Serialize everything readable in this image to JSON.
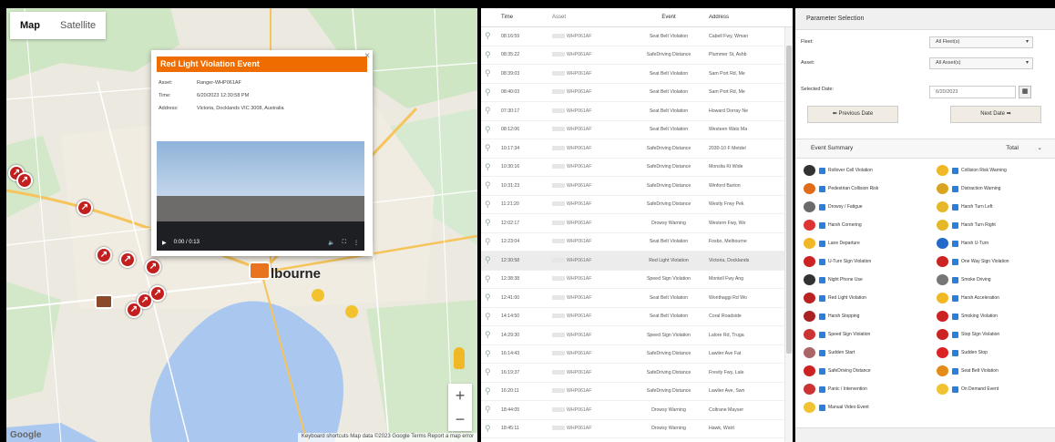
{
  "map": {
    "tabs": [
      "Map",
      "Satellite"
    ],
    "city_label": "lbourne",
    "zoom_in": "+",
    "zoom_out": "−",
    "google": "Google",
    "footer": "Keyboard shortcuts   Map data ©2023 Google   Terms   Report a map error"
  },
  "popup": {
    "title": "Red Light Violation Event",
    "close": "×",
    "rows": [
      {
        "k": "Asset:",
        "v": "Ranger-WHP061AF"
      },
      {
        "k": "Time:",
        "v": "6/20/2023 12:30:58 PM"
      },
      {
        "k": "Address:",
        "v": "Victoria, Docklands VIC 3008, Australia"
      }
    ],
    "video_time": "0:00 / 0:13"
  },
  "table": {
    "headers": [
      "",
      "Time",
      "Asset",
      "Event",
      "Address"
    ],
    "rows": [
      {
        "time": "08:16:59",
        "asset": "WHP061AF",
        "event": "Seat Belt Violation",
        "address": "Cabell Fwy, Wman"
      },
      {
        "time": "08:35:22",
        "asset": "WHP061AF",
        "event": "SafeDriving Distance",
        "address": "Plummer St, Ashb"
      },
      {
        "time": "08:39:03",
        "asset": "WHP061AF",
        "event": "Seat Belt Violation",
        "address": "Sam Port Rd, Me"
      },
      {
        "time": "08:40:03",
        "asset": "WHP061AF",
        "event": "Seat Belt Violation",
        "address": "Sam Port Rd, Me"
      },
      {
        "time": "07:30:17",
        "asset": "WHP061AF",
        "event": "Seat Belt Violation",
        "address": "Howard Dorray Ne"
      },
      {
        "time": "08:12:06",
        "asset": "WHP061AF",
        "event": "Seat Belt Violation",
        "address": "Westeen Wats Ma"
      },
      {
        "time": "10:17:34",
        "asset": "WHP061AF",
        "event": "SafeDriving Distance",
        "address": "2030-10 F Metdel"
      },
      {
        "time": "10:30:16",
        "asset": "WHP061AF",
        "event": "SafeDriving Distance",
        "address": "Monslia Kt Wide"
      },
      {
        "time": "10:31:23",
        "asset": "WHP061AF",
        "event": "SafeDriving Distance",
        "address": "Winford Barton"
      },
      {
        "time": "11:21:20",
        "asset": "WHP061AF",
        "event": "SafeDriving Distance",
        "address": "Westly Frwy Pek"
      },
      {
        "time": "12:02:17",
        "asset": "WHP061AF",
        "event": "Drowsy Warning",
        "address": "Western Fwy, We"
      },
      {
        "time": "12:23:04",
        "asset": "WHP061AF",
        "event": "Seat Belt Violation",
        "address": "Fosbo, Melbourne"
      },
      {
        "time": "12:30:58",
        "asset": "WHP061AF",
        "event": "Red Light Violation",
        "address": "Victoria, Docklands"
      },
      {
        "time": "12:38:38",
        "asset": "WHP061AF",
        "event": "Speed Sign Violation",
        "address": "Montell Fwy Ang"
      },
      {
        "time": "12:41:00",
        "asset": "WHP061AF",
        "event": "Seat Belt Violation",
        "address": "Wonthaggi Rd Wo"
      },
      {
        "time": "14:14:50",
        "asset": "WHP061AF",
        "event": "Seat Belt Violation",
        "address": "Coral Roadside"
      },
      {
        "time": "14:29:30",
        "asset": "WHP061AF",
        "event": "Speed Sign Violation",
        "address": "Lalore Rd, Truga"
      },
      {
        "time": "16:14:43",
        "asset": "WHP061AF",
        "event": "SafeDriving Distance",
        "address": "Lawlier Ave Fat"
      },
      {
        "time": "16:19:37",
        "asset": "WHP061AF",
        "event": "SafeDriving Distance",
        "address": "Frevily Fwy, Lale"
      },
      {
        "time": "16:20:11",
        "asset": "WHP061AF",
        "event": "SafeDriving Distance",
        "address": "Lawlier Ave, Swn"
      },
      {
        "time": "18:44:05",
        "asset": "WHP061AF",
        "event": "Drowsy Warning",
        "address": "Coltrane Mayser"
      },
      {
        "time": "18:45:11",
        "asset": "WHP061AF",
        "event": "Drowsy Warning",
        "address": "Hawk, Wstrt"
      }
    ],
    "selected_index": 12
  },
  "params": {
    "header": "Parameter Selection",
    "fleet_label": "Fleet:",
    "fleet_value": "All Fleet(s)",
    "asset_label": "Asset:",
    "asset_value": "All Asset(s)",
    "date_label": "Selected Date:",
    "date_value": "6/20/2023",
    "prev_btn": "Previous Date",
    "next_btn": "Next Date",
    "summary_header": "Event Summary",
    "total_label": "Total",
    "events_left": [
      "Rollover Cell Violation",
      "Pedestrian Collision Risk",
      "Drowsy / Fatigue",
      "Harsh Cornering",
      "Lane Departure",
      "U-Turn Sign Violation",
      "Night Phone Use",
      "Red Light Violation",
      "Harsh Stopping",
      "Speed Sign Violation",
      "Sudden Start",
      "SafeDriving Distance",
      "Panic / Intervention",
      "Manual Video Event"
    ],
    "events_right": [
      "Collision Risk Warning",
      "Distraction Warning",
      "Harsh Turn Left",
      "Harsh Turn Right",
      "Harsh U-Turn",
      "One Way Sign Violation",
      "Smoke Driving",
      "Harsh Acceleration",
      "Smoking Violation",
      "Stop Sign Violation",
      "Sudden Stop",
      "Seat Belt Violation",
      "On Demand Event"
    ],
    "colors": {
      "checkbox": "#2b7fd8",
      "title_bar": "#ef6c00",
      "pin": "#c41f1f"
    }
  }
}
